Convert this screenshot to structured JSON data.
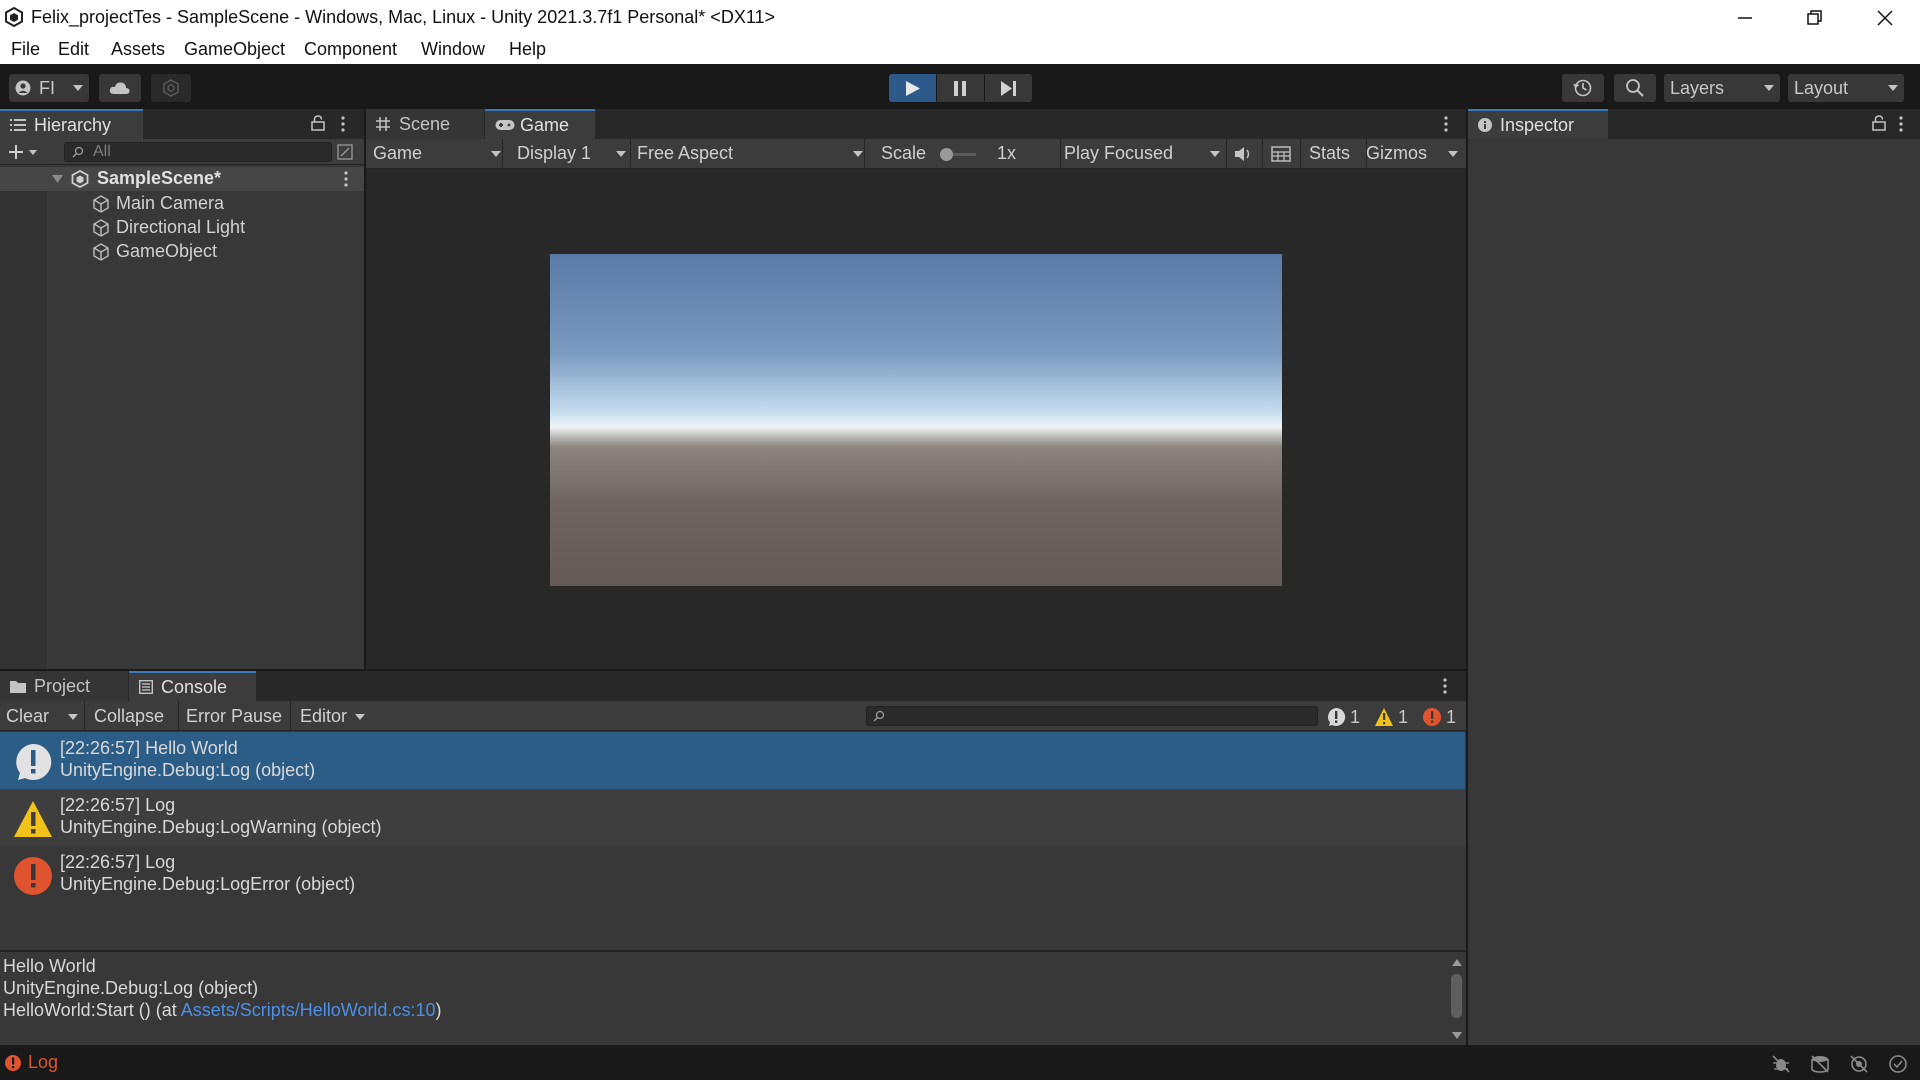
{
  "window": {
    "title": "Felix_projectTes - SampleScene - Windows, Mac, Linux - Unity 2021.3.7f1 Personal* <DX11>"
  },
  "menu": [
    "File",
    "Edit",
    "Assets",
    "GameObject",
    "Component",
    "Window",
    "Help"
  ],
  "toolbar": {
    "account_label": "FI",
    "layers_label": "Layers",
    "layout_label": "Layout"
  },
  "hierarchy": {
    "tab_label": "Hierarchy",
    "search_placeholder": "All",
    "scene_name": "SampleScene*",
    "items": [
      "Main Camera",
      "Directional Light",
      "GameObject"
    ]
  },
  "game_view": {
    "tabs": [
      "Scene",
      "Game"
    ],
    "view_mode": "Game",
    "display": "Display 1",
    "aspect": "Free Aspect",
    "scale_label": "Scale",
    "scale_value": "1x",
    "play_mode": "Play Focused",
    "stats_label": "Stats",
    "gizmos_label": "Gizmos"
  },
  "inspector": {
    "tab_label": "Inspector"
  },
  "console": {
    "tabs": [
      "Project",
      "Console"
    ],
    "clear_label": "Clear",
    "collapse_label": "Collapse",
    "error_pause_label": "Error Pause",
    "editor_label": "Editor",
    "search_placeholder": "",
    "counts": {
      "info": "1",
      "warning": "1",
      "error": "1"
    },
    "entries": [
      {
        "type": "info",
        "line1": "[22:26:57] Hello World",
        "line2": "UnityEngine.Debug:Log (object)"
      },
      {
        "type": "warning",
        "line1": "[22:26:57] Log",
        "line2": "UnityEngine.Debug:LogWarning (object)"
      },
      {
        "type": "error",
        "line1": "[22:26:57] Log",
        "line2": "UnityEngine.Debug:LogError (object)"
      }
    ],
    "detail": {
      "line1": "Hello World",
      "line2": "UnityEngine.Debug:Log (object)",
      "line3_prefix": "HelloWorld:Start () (at ",
      "line3_link": "Assets/Scripts/HelloWorld.cs:10",
      "line3_suffix": ")"
    }
  },
  "statusbar": {
    "message": "Log"
  },
  "colors": {
    "selection": "#2c5d87",
    "accent_blue": "#3a79bb",
    "warning": "#f2c21b",
    "error": "#e0532f"
  }
}
